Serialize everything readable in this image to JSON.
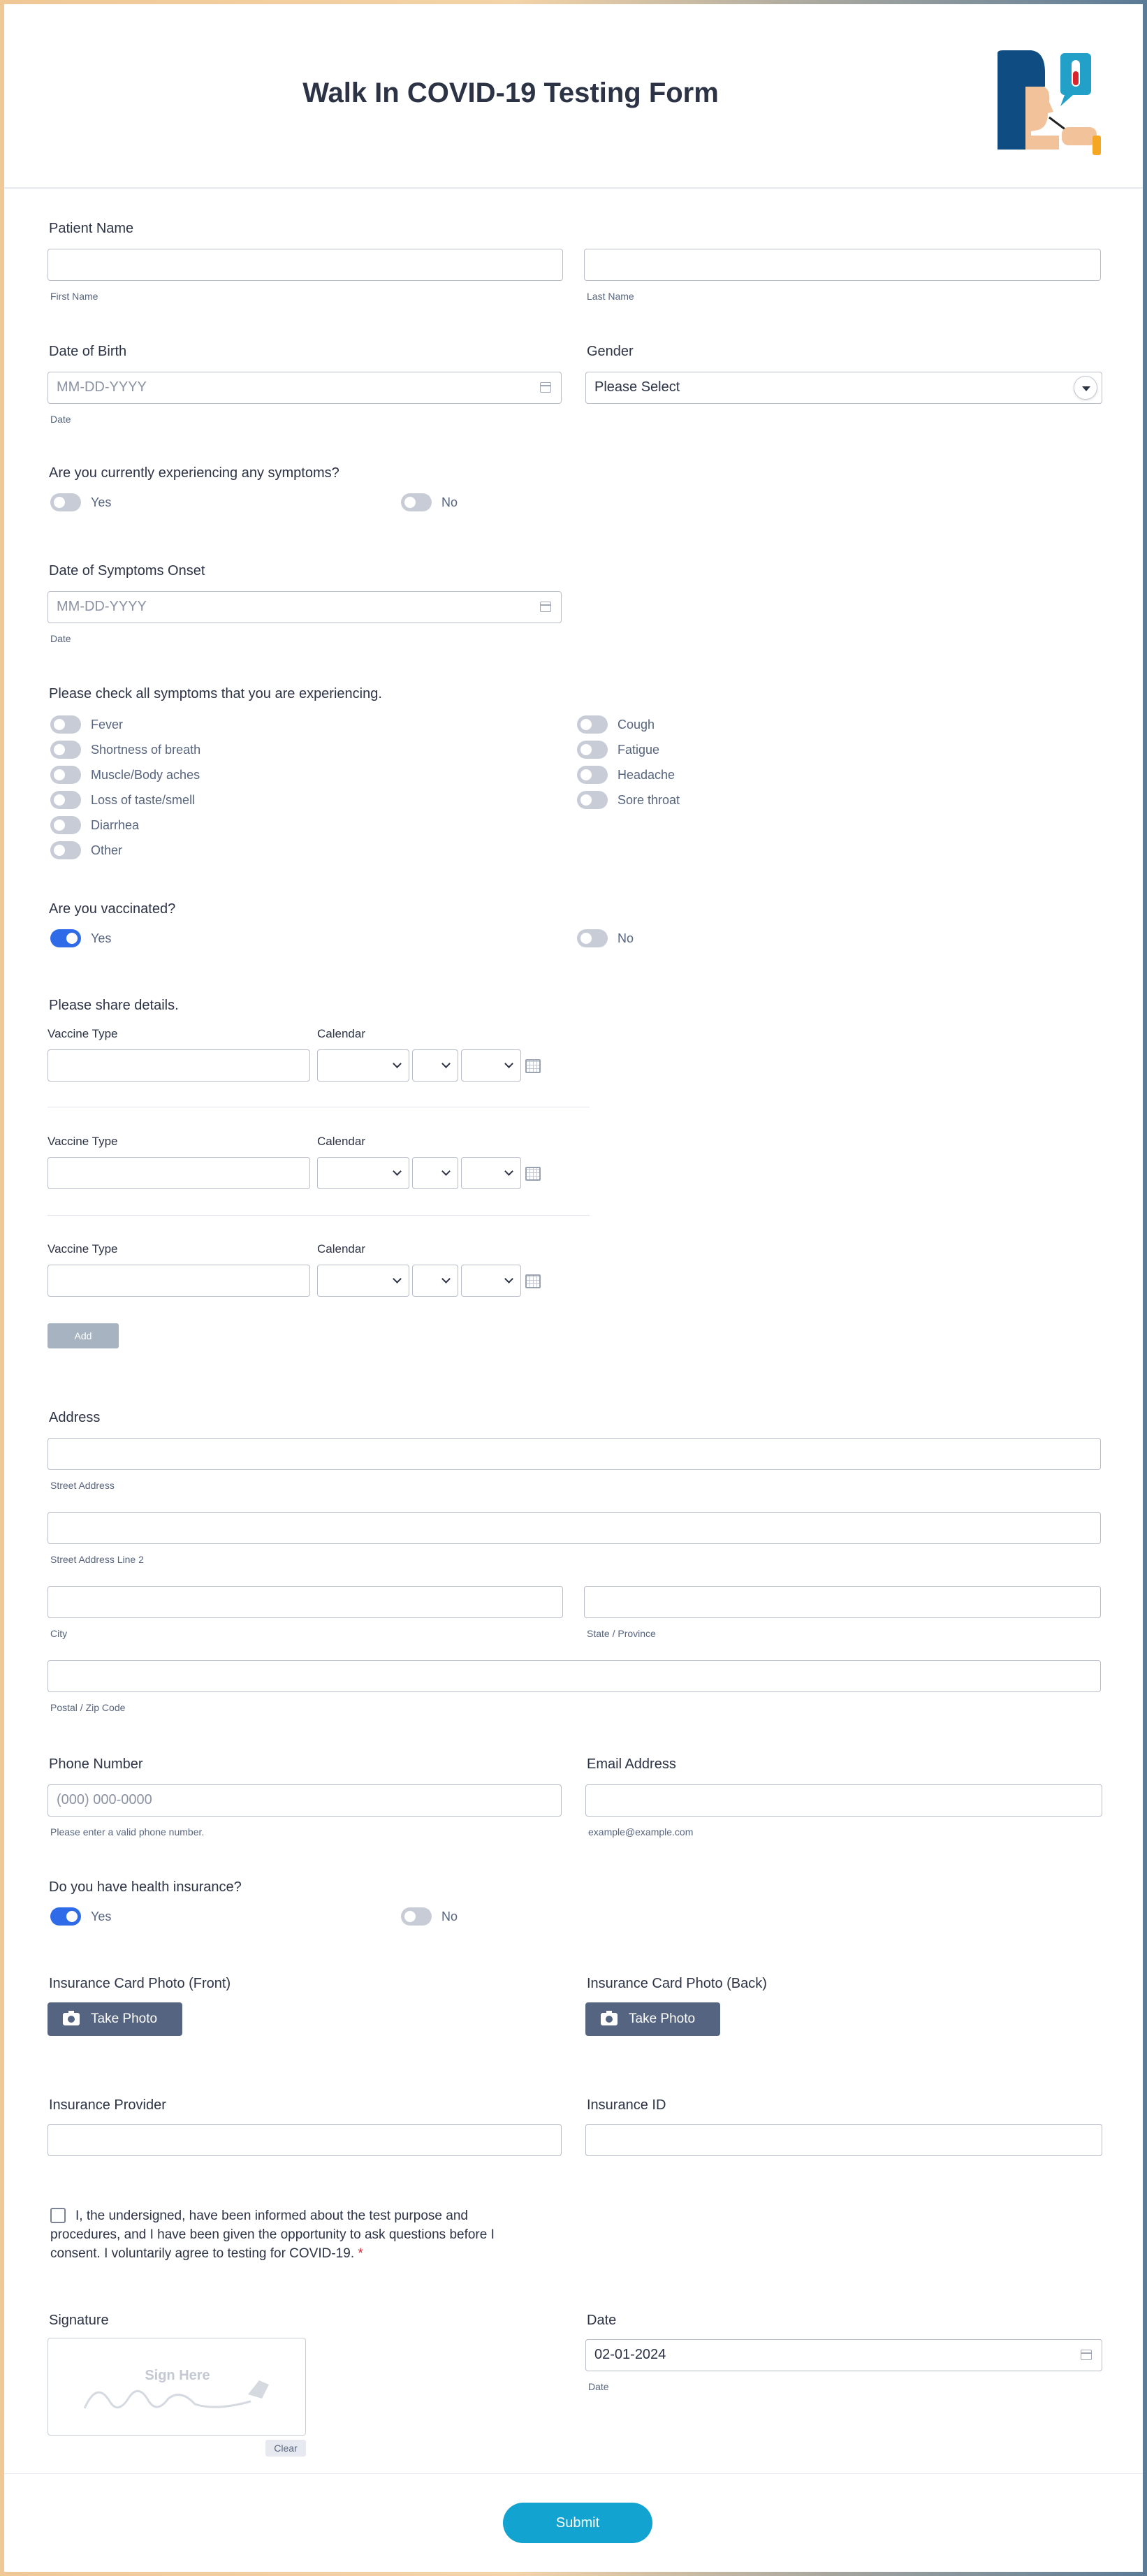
{
  "header": {
    "title": "Walk In COVID-19 Testing Form"
  },
  "patient_name": {
    "label": "Patient Name",
    "first_sub": "First Name",
    "last_sub": "Last Name"
  },
  "dob": {
    "label": "Date of Birth",
    "placeholder": "MM-DD-YYYY",
    "sub": "Date"
  },
  "gender": {
    "label": "Gender",
    "value": "Please Select"
  },
  "symptoms_q": {
    "label": "Are you currently experiencing any symptoms?",
    "yes": "Yes",
    "no": "No",
    "yes_on": false,
    "no_on": false
  },
  "onset": {
    "label": "Date of Symptoms Onset",
    "placeholder": "MM-DD-YYYY",
    "sub": "Date"
  },
  "symptoms_list": {
    "label": "Please check all symptoms that you are experiencing.",
    "left": [
      "Fever",
      "Shortness of breath",
      "Muscle/Body aches",
      "Loss of taste/smell",
      "Diarrhea",
      "Other"
    ],
    "right": [
      "Cough",
      "Fatigue",
      "Headache",
      "Sore throat"
    ]
  },
  "vaccinated": {
    "label": "Are you vaccinated?",
    "yes": "Yes",
    "no": "No",
    "yes_on": true,
    "no_on": false
  },
  "vaccine_details": {
    "label": "Please share details.",
    "type_label": "Vaccine Type",
    "calendar_label": "Calendar",
    "add": "Add"
  },
  "address": {
    "label": "Address",
    "street": "Street Address",
    "street2": "Street Address Line 2",
    "city": "City",
    "state": "State / Province",
    "postal": "Postal / Zip Code"
  },
  "phone": {
    "label": "Phone Number",
    "placeholder": "(000) 000-0000",
    "sub": "Please enter a valid phone number."
  },
  "email": {
    "label": "Email Address",
    "sub": "example@example.com"
  },
  "insurance_q": {
    "label": "Do you have health insurance?",
    "yes": "Yes",
    "no": "No",
    "yes_on": true,
    "no_on": false
  },
  "card_front": {
    "label": "Insurance Card Photo (Front)",
    "button": "Take Photo"
  },
  "card_back": {
    "label": "Insurance Card Photo (Back)",
    "button": "Take Photo"
  },
  "provider": {
    "label": "Insurance Provider"
  },
  "insurance_id": {
    "label": "Insurance ID"
  },
  "consent": {
    "text": "I, the undersigned, have been informed about the test purpose and procedures, and I have been given the opportunity to ask questions before I consent. I voluntarily agree to testing for COVID-19.",
    "required_mark": "*"
  },
  "signature": {
    "label": "Signature",
    "placeholder": "Sign Here",
    "clear": "Clear"
  },
  "date": {
    "label": "Date",
    "value": "02-01-2024",
    "sub": "Date"
  },
  "submit": {
    "label": "Submit"
  },
  "colors": {
    "accent": "#2f6be8",
    "submit": "#12a3d1",
    "photo_button": "#556581"
  }
}
